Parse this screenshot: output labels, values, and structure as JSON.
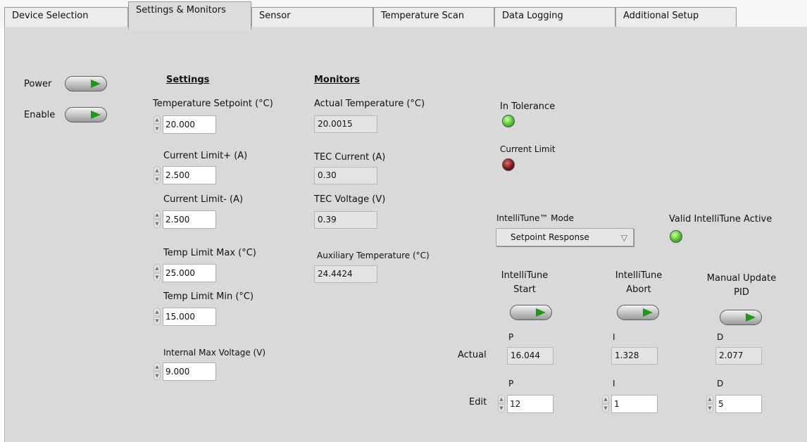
{
  "tabs": [
    "Device Selection",
    "Settings & Monitors",
    "Sensor",
    "Temperature Scan",
    "Data Logging",
    "Additional Setup"
  ],
  "active_tab": "Settings & Monitors",
  "switches": {
    "power_label": "Power",
    "enable_label": "Enable"
  },
  "settings": {
    "header": "Settings",
    "temp_setpoint": {
      "label": "Temperature Setpoint (°C)",
      "value": "20.000"
    },
    "current_limit_plus": {
      "label": "Current Limit+ (A)",
      "value": "2.500"
    },
    "current_limit_minus": {
      "label": "Current Limit- (A)",
      "value": "2.500"
    },
    "temp_limit_max": {
      "label": "Temp Limit Max (°C)",
      "value": "25.000"
    },
    "temp_limit_min": {
      "label": "Temp Limit Min (°C)",
      "value": "15.000"
    },
    "internal_max_voltage": {
      "label": "Internal Max Voltage (V)",
      "value": "9.000"
    }
  },
  "monitors": {
    "header": "Monitors",
    "actual_temperature": {
      "label": "Actual Temperature (°C)",
      "value": "20.0015"
    },
    "tec_current": {
      "label": "TEC Current (A)",
      "value": "0.30"
    },
    "tec_voltage": {
      "label": "TEC Voltage (V)",
      "value": "0.39"
    },
    "auxiliary_temperature": {
      "label": "Auxiliary Temperature (°C)",
      "value": "24.4424"
    }
  },
  "status": {
    "in_tolerance_label": "In Tolerance",
    "current_limit_label": "Current Limit",
    "valid_intellitune_label": "Valid IntelliTune Active"
  },
  "intellitune": {
    "mode_label": "IntelliTune™ Mode",
    "mode_value": "Setpoint Response",
    "start_line1": "IntelliTune",
    "start_line2": "Start",
    "abort_line1": "IntelliTune",
    "abort_line2": "Abort",
    "manual_line1": "Manual Update",
    "manual_line2": "PID"
  },
  "pid": {
    "actual_label": "Actual",
    "edit_label": "Edit",
    "p_label": "P",
    "i_label": "I",
    "d_label": "D",
    "actual_p": "16.044",
    "actual_i": "1.328",
    "actual_d": "2.077",
    "edit_p": "12",
    "edit_i": "1",
    "edit_d": "5"
  },
  "colors": {
    "panel_bg": "#d9d9d9",
    "led_on": "#49c52b",
    "led_off": "#7a0d0d",
    "switch_arrow": "#1b9a16"
  }
}
